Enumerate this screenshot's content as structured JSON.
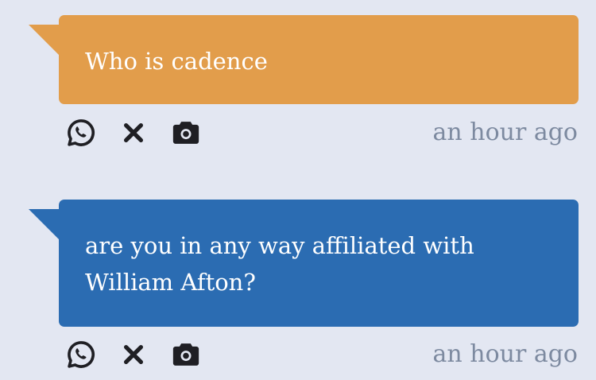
{
  "colors": {
    "background": "#e3e7f2",
    "bubble_orange": "#e29d4b",
    "bubble_blue": "#2b6cb2",
    "bubble_text": "#ffffff",
    "icon": "#1f1f24",
    "timestamp": "#7d8aa0"
  },
  "messages": [
    {
      "text": "Who is cadence",
      "timestamp": "an hour ago",
      "actions": [
        "whatsapp-icon",
        "close-icon",
        "camera-icon"
      ]
    },
    {
      "text": "are you in any way affiliated with William Afton?",
      "timestamp": "an hour ago",
      "actions": [
        "whatsapp-icon",
        "close-icon",
        "camera-icon"
      ]
    }
  ]
}
